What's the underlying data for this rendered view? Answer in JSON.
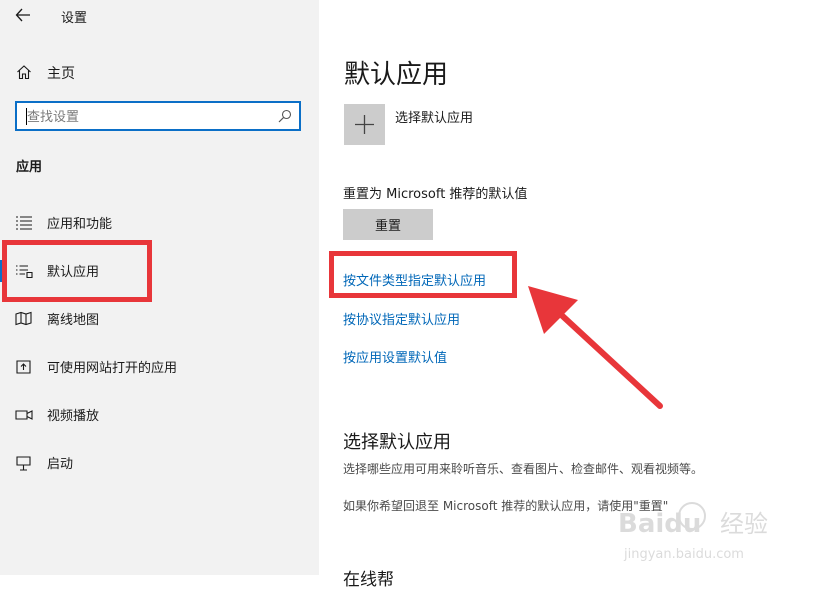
{
  "window": {
    "title": "设置"
  },
  "sidebar": {
    "home": {
      "label": "主页",
      "icon": "home-icon"
    },
    "search": {
      "placeholder": "查找设置",
      "value": "",
      "icon": "search-icon"
    },
    "section_heading": "应用",
    "items": [
      {
        "label": "应用和功能",
        "icon": "apps-features-icon",
        "selected": false
      },
      {
        "label": "默认应用",
        "icon": "default-apps-icon",
        "selected": true
      },
      {
        "label": "离线地图",
        "icon": "offline-maps-icon",
        "selected": false
      },
      {
        "label": "可使用网站打开的应用",
        "icon": "apps-for-websites-icon",
        "selected": false
      },
      {
        "label": "视频播放",
        "icon": "video-playback-icon",
        "selected": false
      },
      {
        "label": "启动",
        "icon": "startup-icon",
        "selected": false
      }
    ]
  },
  "main": {
    "title": "默认应用",
    "choose_app_label": "选择默认应用",
    "reset_description": "重置为 Microsoft 推荐的默认值",
    "reset_button": "重置",
    "links": [
      "按文件类型指定默认应用",
      "按协议指定默认应用",
      "按应用设置默认值"
    ],
    "section2": {
      "title": "选择默认应用",
      "desc1": "选择哪些应用可用来聆听音乐、查看图片、检查邮件、观看视频等。",
      "desc2": "如果你希望回退至 Microsoft 推荐的默认应用，请使用\"重置\""
    },
    "cut_heading": "在线帮"
  },
  "watermark": {
    "brand": "Baidu",
    "brand_cn": "经验",
    "url": "jingyan.baidu.com"
  },
  "colors": {
    "accent": "#0b6fc7",
    "link": "#0067b8",
    "annotation": "#e8363a",
    "sidebar_bg": "#f2f2f2"
  }
}
